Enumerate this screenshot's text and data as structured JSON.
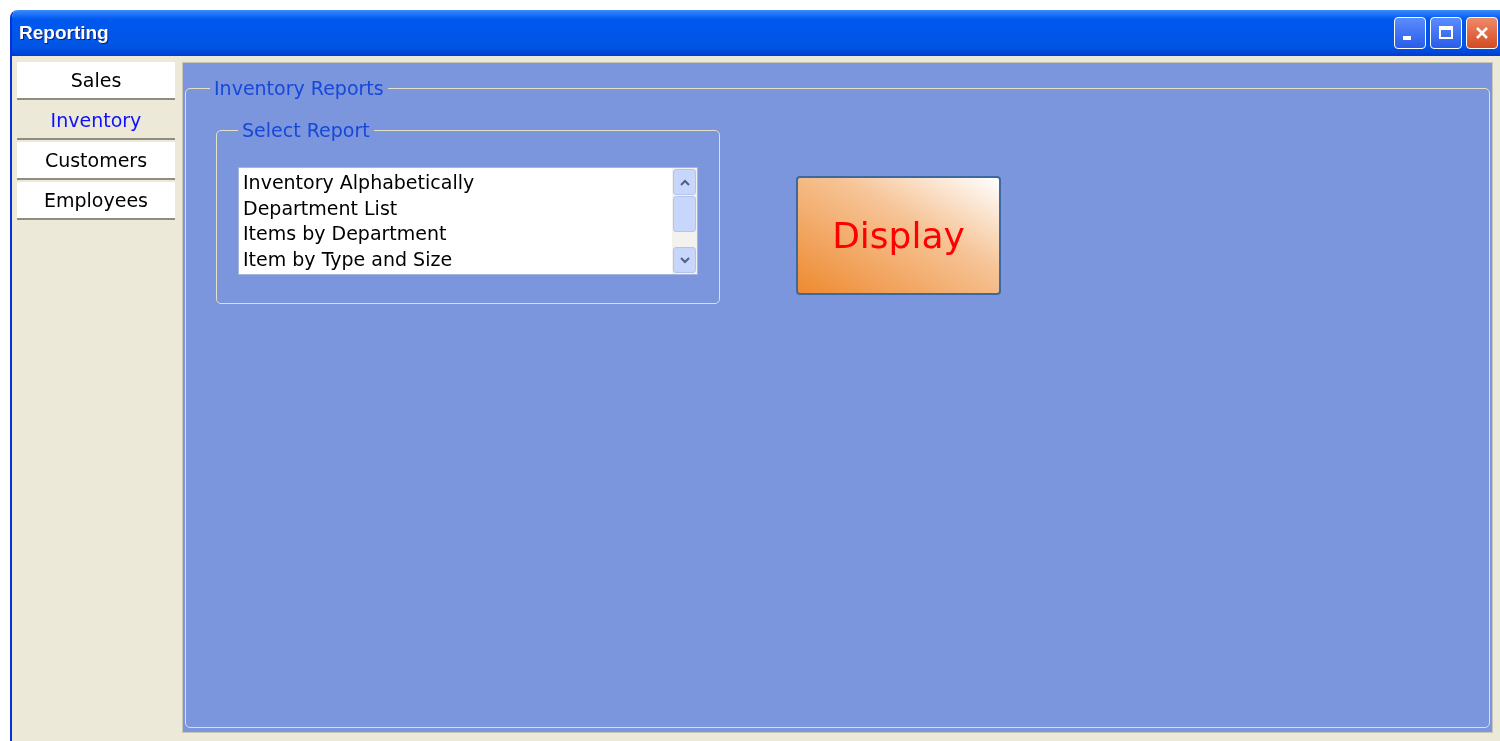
{
  "window": {
    "title": "Reporting"
  },
  "tabs": [
    {
      "label": "Sales",
      "selected": false
    },
    {
      "label": "Inventory",
      "selected": true
    },
    {
      "label": "Customers",
      "selected": false
    },
    {
      "label": "Employees",
      "selected": false
    }
  ],
  "panel": {
    "title": "Inventory Reports",
    "report_group": {
      "title": "Select Report",
      "items": [
        {
          "label": "Inventory Alphabetically",
          "selected": false
        },
        {
          "label": "Department List",
          "selected": false
        },
        {
          "label": "Items by Department",
          "selected": false
        },
        {
          "label": "Item by Type and Size",
          "selected": false
        }
      ]
    },
    "display_button": {
      "label": "Display"
    }
  }
}
